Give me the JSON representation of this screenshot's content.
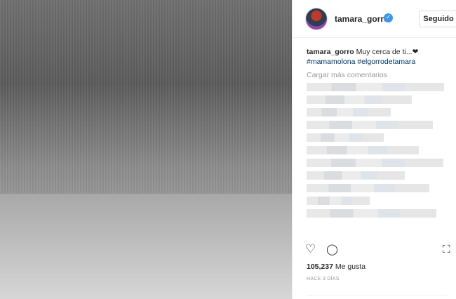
{
  "post": {
    "header": {
      "username": "tamara_gorro",
      "follow_label": "Seguido"
    },
    "caption": {
      "username": "tamara_gorro",
      "text": "Muy cerca de ti...❤",
      "hashtags": "#mamamolona #elgorrodetamara"
    },
    "load_more_label": "Cargar más comentarios",
    "likes": {
      "count": "105,237",
      "label": "Me gusta"
    },
    "timestamp": "HACE 3 DÍAS",
    "icons": {
      "heart": "♡",
      "comment": "◯",
      "bookmark": "⛶",
      "verified": "✓"
    }
  },
  "colors": {
    "accent_link": "#003569",
    "verified_blue": "#3897f0",
    "muted": "#999999"
  }
}
